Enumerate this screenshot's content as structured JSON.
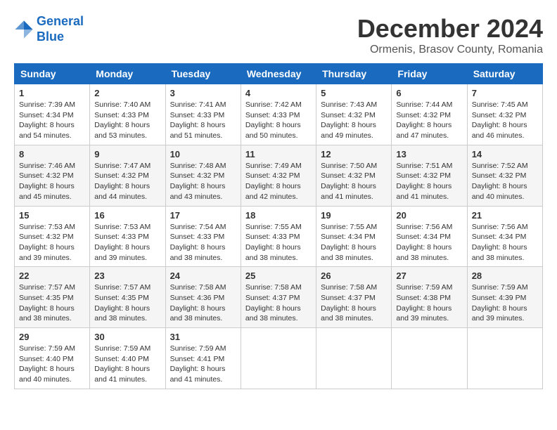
{
  "header": {
    "logo_line1": "General",
    "logo_line2": "Blue",
    "month_title": "December 2024",
    "subtitle": "Ormenis, Brasov County, Romania"
  },
  "days_of_week": [
    "Sunday",
    "Monday",
    "Tuesday",
    "Wednesday",
    "Thursday",
    "Friday",
    "Saturday"
  ],
  "weeks": [
    [
      {
        "day": "1",
        "sunrise": "7:39 AM",
        "sunset": "4:34 PM",
        "daylight": "8 hours and 54 minutes."
      },
      {
        "day": "2",
        "sunrise": "7:40 AM",
        "sunset": "4:33 PM",
        "daylight": "8 hours and 53 minutes."
      },
      {
        "day": "3",
        "sunrise": "7:41 AM",
        "sunset": "4:33 PM",
        "daylight": "8 hours and 51 minutes."
      },
      {
        "day": "4",
        "sunrise": "7:42 AM",
        "sunset": "4:33 PM",
        "daylight": "8 hours and 50 minutes."
      },
      {
        "day": "5",
        "sunrise": "7:43 AM",
        "sunset": "4:32 PM",
        "daylight": "8 hours and 49 minutes."
      },
      {
        "day": "6",
        "sunrise": "7:44 AM",
        "sunset": "4:32 PM",
        "daylight": "8 hours and 47 minutes."
      },
      {
        "day": "7",
        "sunrise": "7:45 AM",
        "sunset": "4:32 PM",
        "daylight": "8 hours and 46 minutes."
      }
    ],
    [
      {
        "day": "8",
        "sunrise": "7:46 AM",
        "sunset": "4:32 PM",
        "daylight": "8 hours and 45 minutes."
      },
      {
        "day": "9",
        "sunrise": "7:47 AM",
        "sunset": "4:32 PM",
        "daylight": "8 hours and 44 minutes."
      },
      {
        "day": "10",
        "sunrise": "7:48 AM",
        "sunset": "4:32 PM",
        "daylight": "8 hours and 43 minutes."
      },
      {
        "day": "11",
        "sunrise": "7:49 AM",
        "sunset": "4:32 PM",
        "daylight": "8 hours and 42 minutes."
      },
      {
        "day": "12",
        "sunrise": "7:50 AM",
        "sunset": "4:32 PM",
        "daylight": "8 hours and 41 minutes."
      },
      {
        "day": "13",
        "sunrise": "7:51 AM",
        "sunset": "4:32 PM",
        "daylight": "8 hours and 41 minutes."
      },
      {
        "day": "14",
        "sunrise": "7:52 AM",
        "sunset": "4:32 PM",
        "daylight": "8 hours and 40 minutes."
      }
    ],
    [
      {
        "day": "15",
        "sunrise": "7:53 AM",
        "sunset": "4:32 PM",
        "daylight": "8 hours and 39 minutes."
      },
      {
        "day": "16",
        "sunrise": "7:53 AM",
        "sunset": "4:33 PM",
        "daylight": "8 hours and 39 minutes."
      },
      {
        "day": "17",
        "sunrise": "7:54 AM",
        "sunset": "4:33 PM",
        "daylight": "8 hours and 38 minutes."
      },
      {
        "day": "18",
        "sunrise": "7:55 AM",
        "sunset": "4:33 PM",
        "daylight": "8 hours and 38 minutes."
      },
      {
        "day": "19",
        "sunrise": "7:55 AM",
        "sunset": "4:34 PM",
        "daylight": "8 hours and 38 minutes."
      },
      {
        "day": "20",
        "sunrise": "7:56 AM",
        "sunset": "4:34 PM",
        "daylight": "8 hours and 38 minutes."
      },
      {
        "day": "21",
        "sunrise": "7:56 AM",
        "sunset": "4:34 PM",
        "daylight": "8 hours and 38 minutes."
      }
    ],
    [
      {
        "day": "22",
        "sunrise": "7:57 AM",
        "sunset": "4:35 PM",
        "daylight": "8 hours and 38 minutes."
      },
      {
        "day": "23",
        "sunrise": "7:57 AM",
        "sunset": "4:35 PM",
        "daylight": "8 hours and 38 minutes."
      },
      {
        "day": "24",
        "sunrise": "7:58 AM",
        "sunset": "4:36 PM",
        "daylight": "8 hours and 38 minutes."
      },
      {
        "day": "25",
        "sunrise": "7:58 AM",
        "sunset": "4:37 PM",
        "daylight": "8 hours and 38 minutes."
      },
      {
        "day": "26",
        "sunrise": "7:58 AM",
        "sunset": "4:37 PM",
        "daylight": "8 hours and 38 minutes."
      },
      {
        "day": "27",
        "sunrise": "7:59 AM",
        "sunset": "4:38 PM",
        "daylight": "8 hours and 39 minutes."
      },
      {
        "day": "28",
        "sunrise": "7:59 AM",
        "sunset": "4:39 PM",
        "daylight": "8 hours and 39 minutes."
      }
    ],
    [
      {
        "day": "29",
        "sunrise": "7:59 AM",
        "sunset": "4:40 PM",
        "daylight": "8 hours and 40 minutes."
      },
      {
        "day": "30",
        "sunrise": "7:59 AM",
        "sunset": "4:40 PM",
        "daylight": "8 hours and 41 minutes."
      },
      {
        "day": "31",
        "sunrise": "7:59 AM",
        "sunset": "4:41 PM",
        "daylight": "8 hours and 41 minutes."
      },
      null,
      null,
      null,
      null
    ]
  ],
  "labels": {
    "sunrise": "Sunrise:",
    "sunset": "Sunset:",
    "daylight": "Daylight:"
  }
}
